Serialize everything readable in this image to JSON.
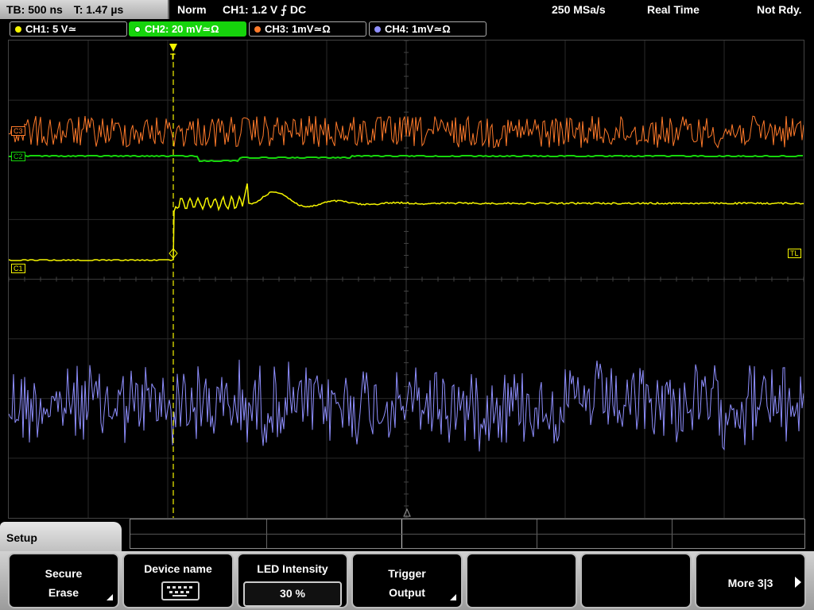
{
  "topbar": {
    "timebase": "TB: 500 ns",
    "trigger_time": "T: 1.47 µs",
    "mode": "Norm",
    "trigger_setting": "CH1: 1.2 V ⨍ DC",
    "sample_rate": "250 MSa/s",
    "acq_mode": "Real Time",
    "status": "Not Rdy."
  },
  "channels": [
    {
      "label": "CH1: 5 V≃",
      "color": "#f5f500",
      "active": false
    },
    {
      "label": "CH2: 20 mV≃Ω",
      "color": "#16d40c",
      "active": true
    },
    {
      "label": "CH3: 1mV≃Ω",
      "color": "#ff7a2a",
      "active": false
    },
    {
      "label": "CH4: 1mV≃Ω",
      "color": "#8f8fff",
      "active": false
    }
  ],
  "screen": {
    "markers": {
      "c3": "C3",
      "c2": "C2",
      "c1": "C1",
      "trigger_level": "TL",
      "trigger_pos": "T"
    }
  },
  "menu": {
    "title": "Setup"
  },
  "softkeys": {
    "secure_erase": {
      "line1": "Secure",
      "line2": "Erase"
    },
    "device_name": {
      "line1": "Device name",
      "icon": "keyboard-icon"
    },
    "led_intensity": {
      "line1": "LED Intensity",
      "value": "30 %"
    },
    "trigger_output": {
      "line1": "Trigger",
      "line2": "Output"
    },
    "more": {
      "line1": "More 3|3"
    }
  }
}
